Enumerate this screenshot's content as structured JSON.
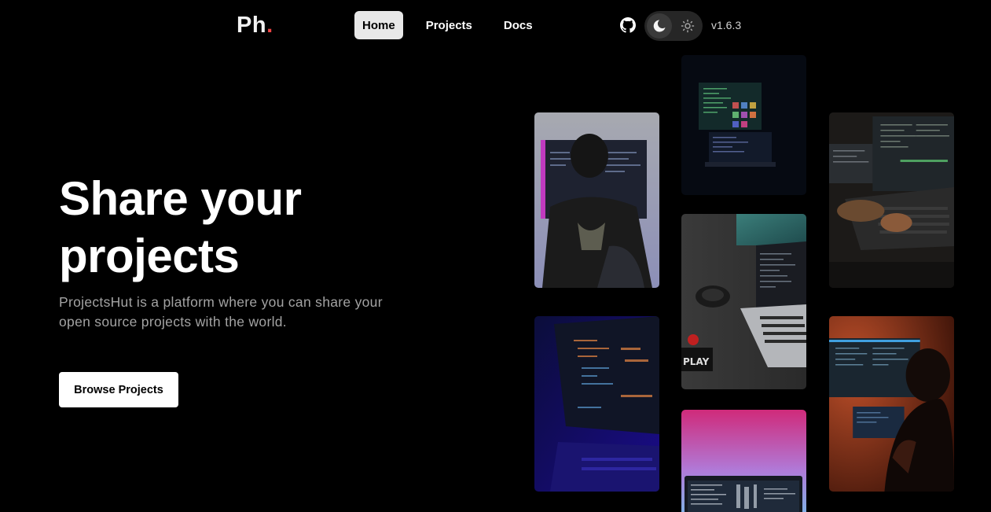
{
  "header": {
    "logo_text": "Ph",
    "logo_dot": ".",
    "nav": [
      {
        "label": "Home",
        "active": true
      },
      {
        "label": "Projects",
        "active": false
      },
      {
        "label": "Docs",
        "active": false
      }
    ],
    "github_icon": "github-icon",
    "theme_toggle": {
      "selected": "dark",
      "icons": [
        "moon-icon",
        "sun-icon"
      ]
    },
    "version": "v1.6.3"
  },
  "hero": {
    "title_line1": "Share your",
    "title_line2": "projects",
    "subtitle": "ProjectsHut is a platform where you can share your open source projects with the world.",
    "cta_label": "Browse Projects"
  },
  "colors": {
    "background": "#000000",
    "accent_dot": "#ef4444",
    "active_nav_bg": "#e8e8e8"
  }
}
